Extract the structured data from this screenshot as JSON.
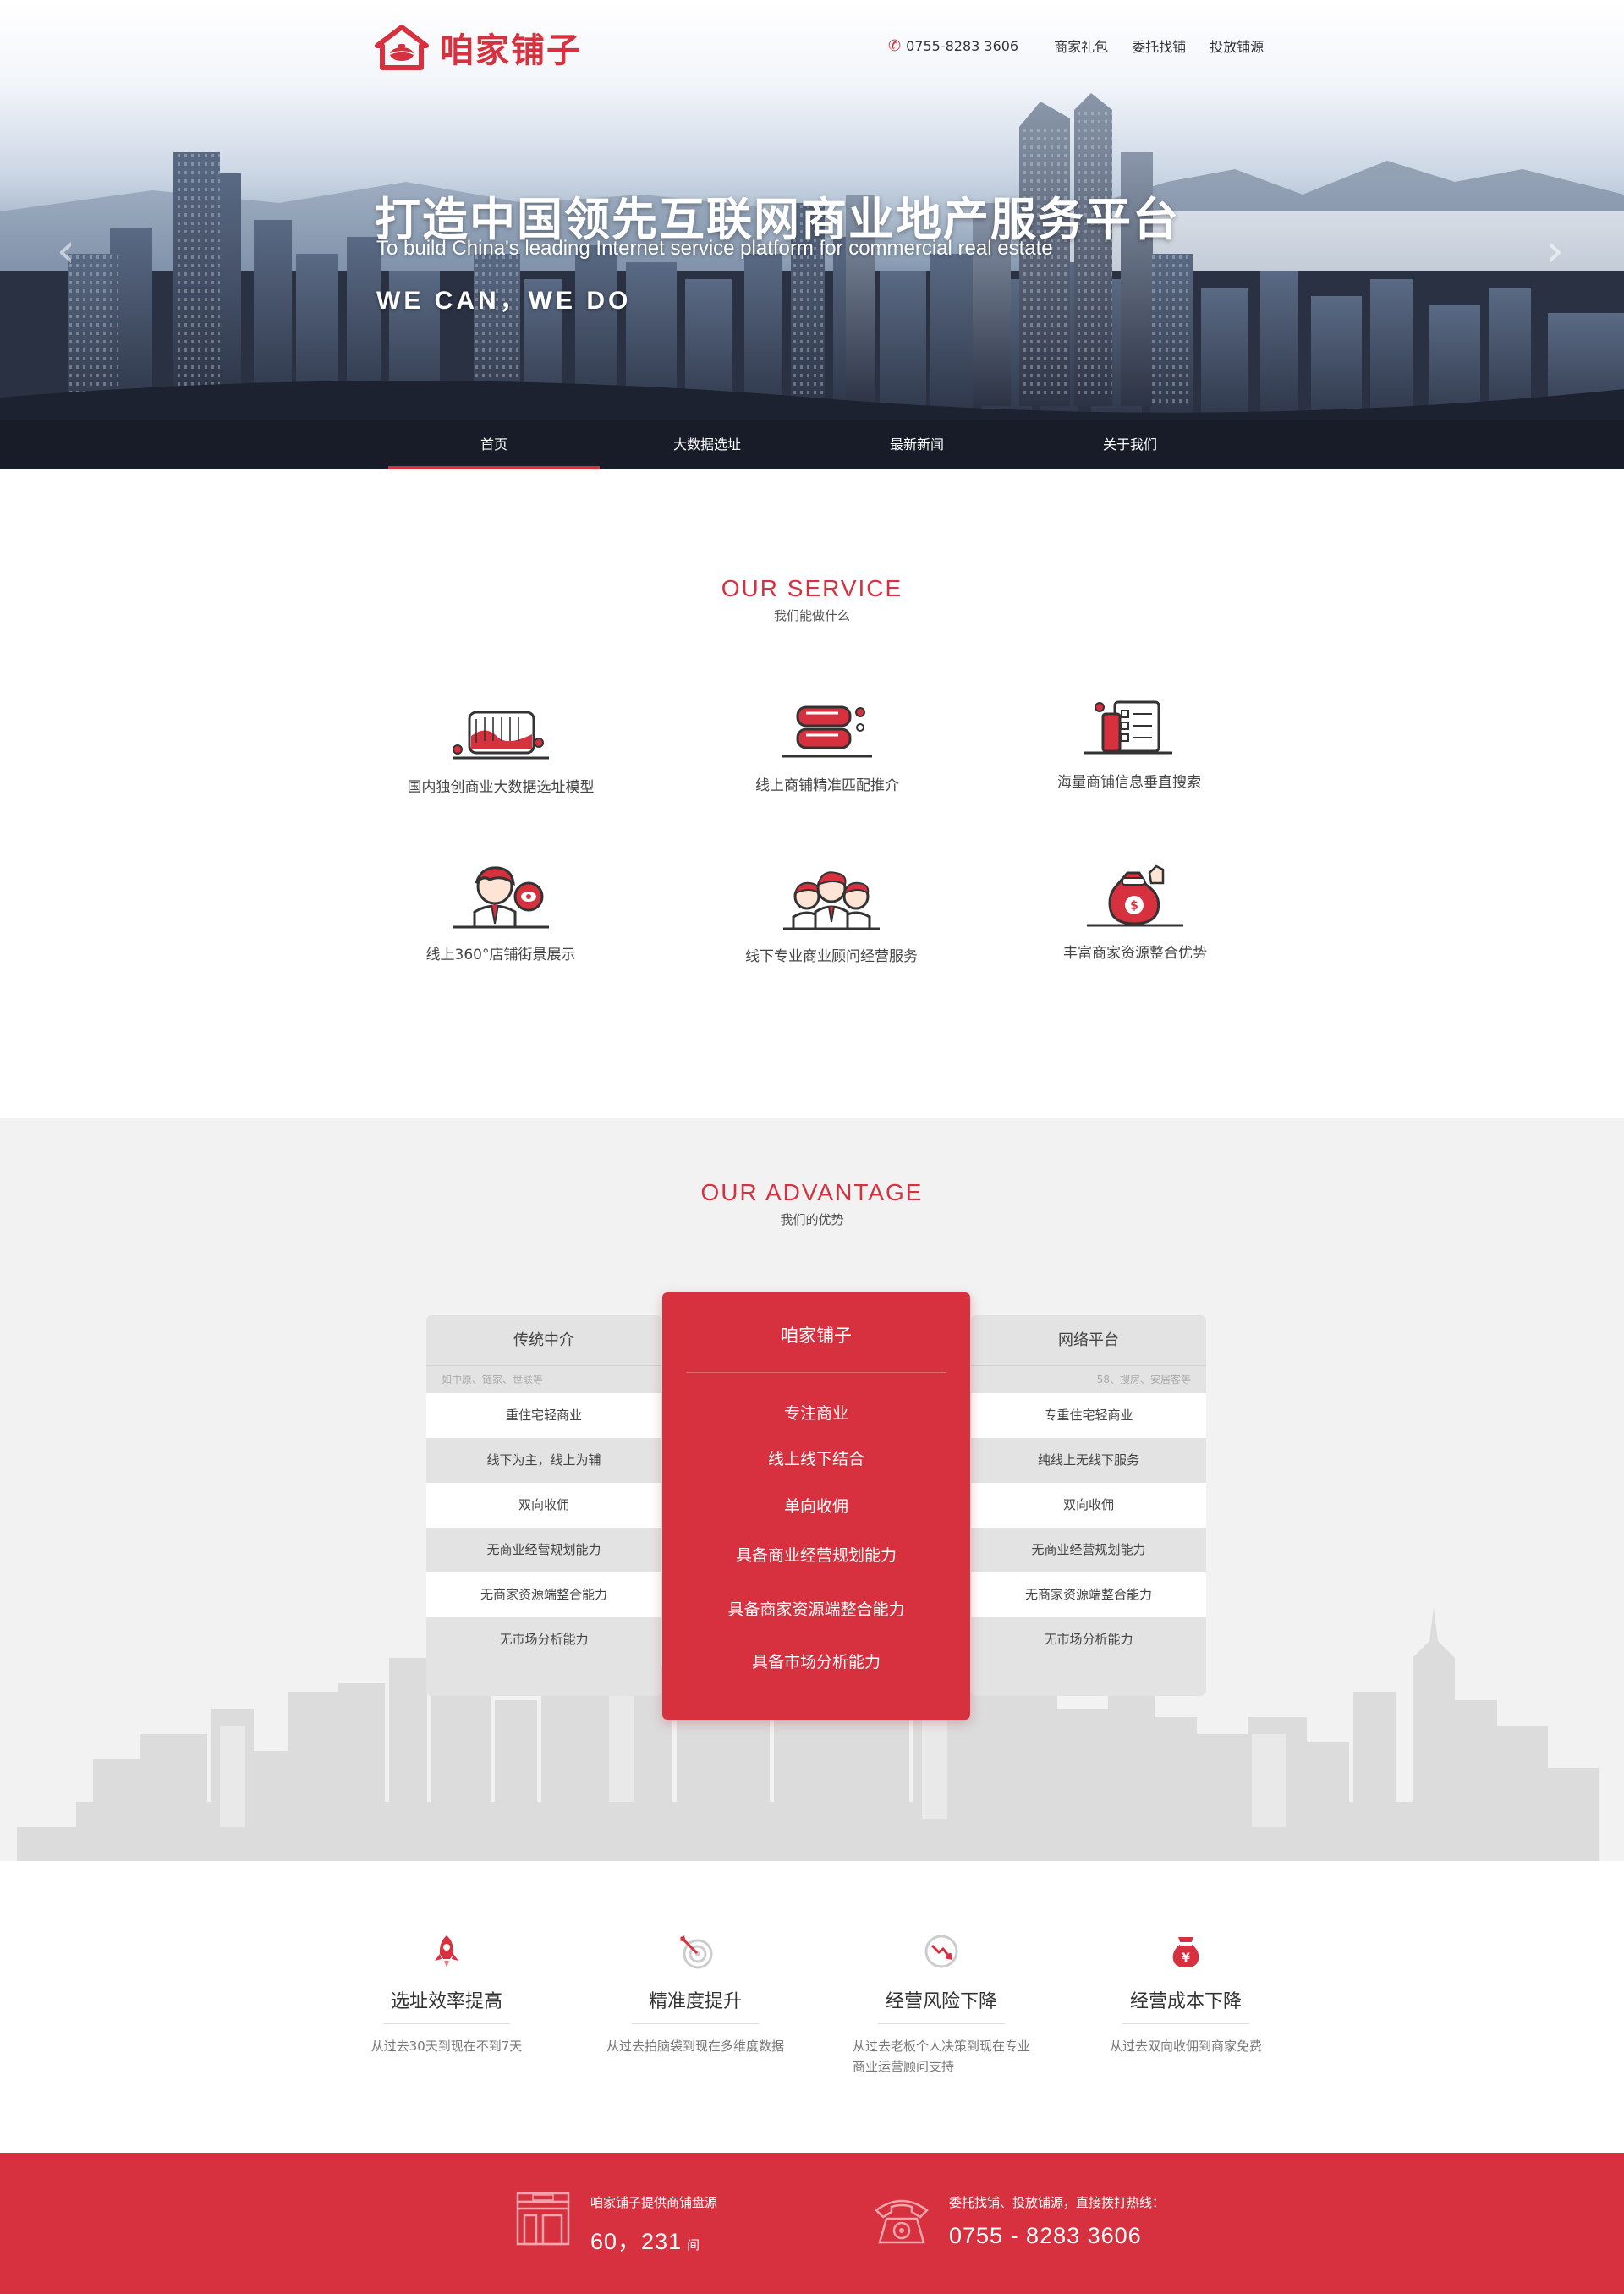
{
  "brand": {
    "name": "咱家铺子",
    "color": "#d7303e"
  },
  "top_links": {
    "phone": "0755-8283 3606",
    "items": [
      "商家礼包",
      "委托找铺",
      "投放铺源"
    ]
  },
  "hero": {
    "title": "打造中国领先互联网商业地产服务平台",
    "subtitle": "To build China's leading Internet service platform for commercial real estate",
    "motto": "WE CAN，WE DO",
    "prev_icon": "chevron-left-icon",
    "next_icon": "chevron-right-icon"
  },
  "nav": {
    "items": [
      "首页",
      "大数据选址",
      "最新新闻",
      "关于我们"
    ],
    "active": "首页"
  },
  "service": {
    "title": "OUR  SERVICE",
    "subtitle": "我们能做什么",
    "items": [
      {
        "label": "国内独创商业大数据选址模型",
        "icon": "map-chart-icon"
      },
      {
        "label": "线上商铺精准匹配推介",
        "icon": "database-icon"
      },
      {
        "label": "海量商铺信息垂直搜索",
        "icon": "checklist-icon"
      },
      {
        "label": "线上360°店铺街景展示",
        "icon": "person-eye-icon"
      },
      {
        "label": "线下专业商业顾问经营服务",
        "icon": "team-icon"
      },
      {
        "label": "丰富商家资源整合优势",
        "icon": "money-bag-icon"
      }
    ]
  },
  "advantage": {
    "title": "OUR  ADVANTAGE",
    "subtitle": "我们的优势",
    "left": {
      "heading": "传统中介",
      "note": "如中原、链家、世联等",
      "rows": [
        "重住宅轻商业",
        "线下为主，线上为辅",
        "双向收佣",
        "无商业经营规划能力",
        "无商家资源端整合能力",
        "无市场分析能力"
      ]
    },
    "middle": {
      "heading": "咱家铺子",
      "rows": [
        "专注商业",
        "线上线下结合",
        "单向收佣",
        "具备商业经营规划能力",
        "具备商家资源端整合能力",
        "具备市场分析能力"
      ]
    },
    "right": {
      "heading": "网络平台",
      "note": "58、搜房、安居客等",
      "rows": [
        "专重住宅轻商业",
        "纯线上无线下服务",
        "双向收佣",
        "无商业经营规划能力",
        "无商家资源端整合能力",
        "无市场分析能力"
      ]
    }
  },
  "features": [
    {
      "title": "选址效率提高",
      "desc": "从过去30天到现在不到7天",
      "icon": "rocket-icon"
    },
    {
      "title": "精准度提升",
      "desc": "从过去拍脑袋到现在多维度数据",
      "icon": "target-icon"
    },
    {
      "title": "经营风险下降",
      "desc": "从过去老板个人决策到现在专业商业运营顾问支持",
      "icon": "trend-down-icon"
    },
    {
      "title": "经营成本下降",
      "desc": "从过去双向收佣到商家免费",
      "icon": "yen-bag-icon"
    }
  ],
  "footer": {
    "listings_label": "咱家铺子提供商铺盘源",
    "listings_value": "60，231",
    "listings_unit": "间",
    "hotline_label": "委托找铺、投放铺源，直接拨打热线：",
    "hotline_value": "0755 - 8283 3606",
    "shop_icon": "storefront-icon",
    "phone_icon": "telephone-icon"
  }
}
